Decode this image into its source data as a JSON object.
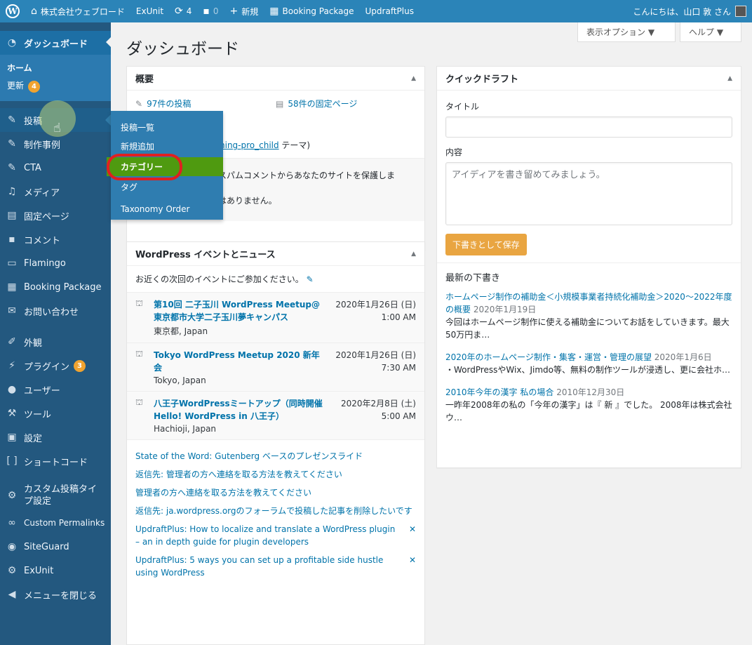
{
  "adminbar": {
    "site_name": "株式会社ウェブロード",
    "exunit": "ExUnit",
    "updates_count": "4",
    "comments_count": "0",
    "new_label": "新規",
    "booking": "Booking Package",
    "updraft": "UpdraftPlus",
    "greeting": "こんにちは、山口 敦 さん"
  },
  "sidebar": {
    "dashboard": "ダッシュボード",
    "home": "ホーム",
    "updates": "更新",
    "updates_count": "4",
    "posts": "投稿",
    "works": "制作事例",
    "cta": "CTA",
    "media": "メディア",
    "pages": "固定ページ",
    "comments": "コメント",
    "flamingo": "Flamingo",
    "booking": "Booking Package",
    "contact": "お問い合わせ",
    "appearance": "外観",
    "plugins": "プラグイン",
    "plugins_count": "3",
    "users": "ユーザー",
    "tools": "ツール",
    "settings": "設定",
    "shortcode": "ショートコード",
    "custom_post": "カスタム投稿タイプ設定",
    "custom_permalinks": "Custom Permalinks",
    "siteguard": "SiteGuard",
    "exunit": "ExUnit",
    "collapse": "メニューを閉じる"
  },
  "flyout": {
    "all_posts": "投稿一覧",
    "add_new": "新規追加",
    "categories": "カテゴリー",
    "tags": "タグ",
    "taxonomy": "Taxonomy Order"
  },
  "header": {
    "title": "ダッシュボード",
    "screen_options": "表示オプション ▼",
    "help": "ヘルプ ▼"
  },
  "glance": {
    "title": "概要",
    "posts": "97件の投稿",
    "pages": "58件の固定ページ",
    "theme_partial": "ning-pro_child",
    "theme_suffix": " テーマ)",
    "spam_text": "スパムコメントからあなたのサイトを保護しま",
    "spam_text2": "はありません。"
  },
  "events": {
    "title": "WordPress イベントとニュース",
    "intro": "お近くの次回のイベントにご参加ください。",
    "items": [
      {
        "title": "第10回 二子玉川 WordPress Meetup@東京都市大学二子玉川夢キャンパス",
        "location": "東京都, Japan",
        "date": "2020年1月26日 (日)",
        "time": "1:00 AM"
      },
      {
        "title": "Tokyo WordPress Meetup 2020 新年会",
        "location": "Tokyo, Japan",
        "date": "2020年1月26日 (日)",
        "time": "7:30 AM"
      },
      {
        "title": "八王子WordPressミートアップ（同時開催Hello! WordPress in 八王子）",
        "location": "Hachioji, Japan",
        "date": "2020年2月8日 (土)",
        "time": "5:00 AM"
      }
    ],
    "news": [
      "State of the Word: Gutenberg ベースのプレゼンスライド",
      "返信先: 管理者の方へ連絡を取る方法を教えてください",
      "管理者の方へ連絡を取る方法を教えてください",
      "返信先: ja.wordpress.orgのフォーラムで投稿した記事を削除したいです",
      "UpdraftPlus: How to localize and translate a WordPress plugin – an in depth guide for plugin developers",
      "UpdraftPlus: 5 ways you can set up a profitable side hustle using WordPress"
    ]
  },
  "quickdraft": {
    "title": "クイックドラフト",
    "title_label": "タイトル",
    "content_label": "内容",
    "content_placeholder": "アイディアを書き留めてみましょう。",
    "save_button": "下書きとして保存",
    "recent_title": "最新の下書き",
    "drafts": [
      {
        "title": "ホームページ制作の補助金＜小規模事業者持続化補助金＞2020～2022年度の概要",
        "date": "2020年1月19日",
        "excerpt": "今回はホームページ制作に使える補助金についてお話をしていきます。最大50万円ま…"
      },
      {
        "title": "2020年のホームページ制作・集客・運営・管理の展望",
        "date": "2020年1月6日",
        "excerpt": "・WordPressやWix、Jimdo等、無料の制作ツールが浸透し、更に会社ホ…"
      },
      {
        "title": "2010年今年の漢字 私の場合",
        "date": "2010年12月30日",
        "excerpt": "一昨年2008年の私の「今年の漢字」は『 新 』でした。 2008年は株式会社ウ…"
      }
    ]
  }
}
